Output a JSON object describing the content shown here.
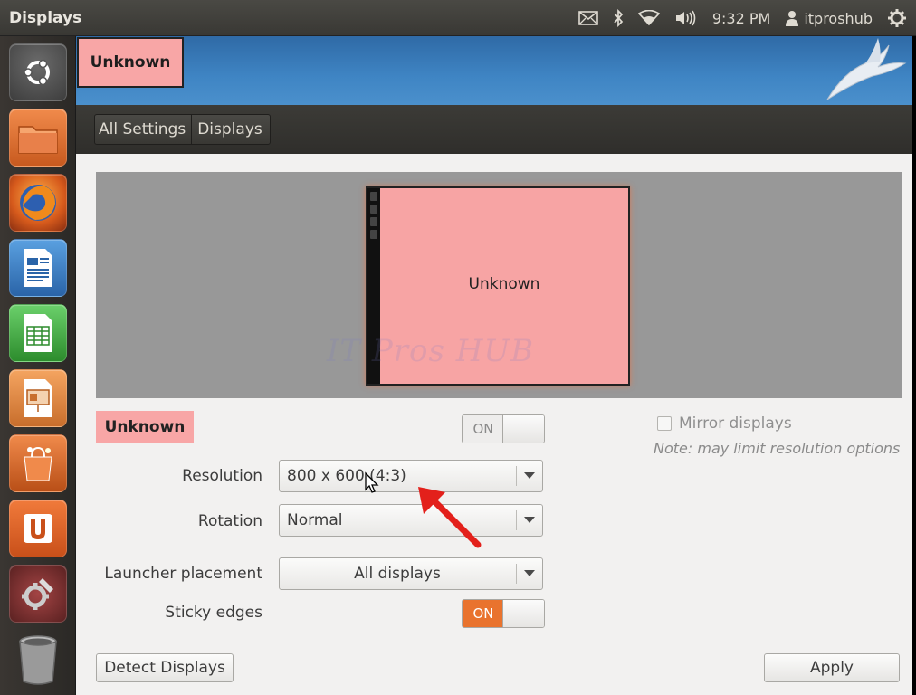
{
  "panel": {
    "app_title": "Displays",
    "clock": "9:32 PM",
    "user": "itproshub"
  },
  "launcher": {
    "items": [
      "dash",
      "files",
      "firefox",
      "libreoffice-writer",
      "libreoffice-calc",
      "libreoffice-impress",
      "software-center",
      "ubuntu-one",
      "system-settings",
      "trash"
    ]
  },
  "wallpaper": {
    "display_badge": "Unknown"
  },
  "toolbar": {
    "crumbs": [
      "All Settings",
      "Displays"
    ]
  },
  "preview": {
    "monitor_label": "Unknown",
    "watermark": "IT Pros HUB"
  },
  "display": {
    "name": "Unknown",
    "power_switch": "ON",
    "mirror_label": "Mirror displays",
    "mirror_checked": false,
    "mirror_note": "Note: may limit resolution options"
  },
  "settings": {
    "resolution_label": "Resolution",
    "resolution_value": "800 x 600 (4:3)",
    "rotation_label": "Rotation",
    "rotation_value": "Normal",
    "launcher_label": "Launcher placement",
    "launcher_value": "All displays",
    "sticky_label": "Sticky edges",
    "sticky_switch": "ON"
  },
  "buttons": {
    "detect": "Detect Displays",
    "apply": "Apply"
  },
  "colors": {
    "accent_orange": "#e9732e",
    "display_pink": "#f8a6a6",
    "annotation_red": "#e3201b"
  }
}
